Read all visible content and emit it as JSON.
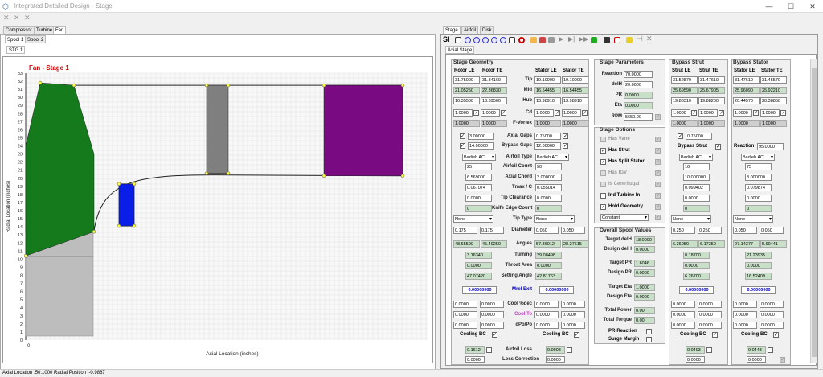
{
  "window": {
    "title": "Integrated Detailed Design - Stage",
    "minimize": "—",
    "maximize": "☐",
    "close": "✕"
  },
  "left": {
    "tabs": [
      "Compressor",
      "Turbine",
      "Fan"
    ],
    "spool_tabs": [
      "Spool 1",
      "Spool 2"
    ],
    "stage_tab": "STG 1",
    "plot": {
      "title": "Fan - Stage 1",
      "xlabel": "Axial Location (inches)",
      "ylabel": "Radial Location (inches)",
      "x_zero": "0",
      "yticks": [
        "0",
        "1",
        "2",
        "3",
        "4",
        "5",
        "6",
        "7",
        "8",
        "9",
        "10",
        "11",
        "12",
        "13",
        "14",
        "15",
        "16",
        "17",
        "18",
        "19",
        "20",
        "21",
        "22",
        "23",
        "24",
        "25",
        "26",
        "27",
        "28",
        "29",
        "30",
        "31",
        "32",
        "33"
      ],
      "colors": {
        "rotor": "#157a1c",
        "stator": "#7f7f7f",
        "bypass": "#7a0a82",
        "core": "#0a1ee8",
        "hub": "#bdbdbd"
      }
    }
  },
  "right": {
    "tabs": [
      "Stage",
      "Airfoil",
      "Disk"
    ],
    "subtab": "Axial Stage",
    "geometry": {
      "header": "Stage Geometry",
      "col_headers": [
        "Rotor LE",
        "Rotor TE",
        "Stator LE",
        "Stator TE"
      ],
      "rows": [
        {
          "label": "Tip",
          "rotor": [
            "31.75000",
            "31.34160"
          ],
          "stator": [
            "19.10000",
            "19.10000"
          ]
        },
        {
          "label": "Mid",
          "rotor": [
            "21.05250",
            "22.36830"
          ],
          "stator": [
            "16.54455",
            "16.54455"
          ]
        },
        {
          "label": "Hub",
          "rotor": [
            "10.35500",
            "13.39500"
          ],
          "stator": [
            "13.98910",
            "13.98910"
          ]
        },
        {
          "label": "Cd",
          "rotor": [
            "1.0000",
            "1.0000"
          ],
          "stator": [
            "1.0000",
            "1.0000"
          ]
        },
        {
          "label": "F-Vortex",
          "rotor": [
            "1.0000",
            "1.0000"
          ],
          "stator": [
            "1.0000",
            "1.0000"
          ]
        }
      ],
      "axial_gaps": {
        "label": "Axial Gaps",
        "rotor": "3.00000",
        "stator": "0.75000"
      },
      "bypass_gaps": {
        "label": "Bypass Gaps",
        "rotor": "14.00000",
        "stator": "12.00000"
      },
      "airfoil_type": {
        "label": "Airfoil Type",
        "rotor": "Badieh AC",
        "stator": "Badieh AC"
      },
      "airfoil_count": {
        "label": "Airfoil Count",
        "rotor": "25",
        "stator": "50"
      },
      "axial_chord": {
        "label": "Axial Chord",
        "rotor": "6.569000",
        "stator": "2.000000"
      },
      "tmax_c": {
        "label": "Tmax / C",
        "rotor": "0.067074",
        "stator": "0.055014"
      },
      "tip_clearance": {
        "label": "Tip Clearance",
        "rotor": "0.0000",
        "stator": "0.0000"
      },
      "knife_edge": {
        "label": "Knife Edge Count",
        "rotor": "0",
        "stator": "0"
      },
      "tip_type": {
        "label": "Tip Type",
        "rotor": "None",
        "stator": "None"
      },
      "diameter": {
        "label": "Diameter",
        "rotor": [
          "0.175",
          "0.175"
        ],
        "stator": [
          "0.050",
          "0.050"
        ]
      },
      "angles": {
        "label": "Angles",
        "rotor": [
          "48.65590",
          "45.49250"
        ],
        "stator": [
          "57.36012",
          "28.27515"
        ]
      },
      "turning": {
        "label": "Turning",
        "rotor": "3.16340",
        "stator": "29.08498"
      },
      "throat_area": {
        "label": "Throat Area",
        "rotor": "0.0000",
        "stator": "0.0000"
      },
      "setting_angle": {
        "label": "Setting Angle",
        "rotor": "47.07420",
        "stator": "42.81763"
      },
      "mrel_exit": {
        "label": "Mrel Exit",
        "rotor": "0.00000000",
        "stator": "0.00000000"
      },
      "cool_pct": {
        "label": "Cool %dec",
        "rotor": [
          "0.0000",
          "0.0000"
        ],
        "stator": [
          "0.0000",
          "0.0000"
        ]
      },
      "cool_to": {
        "label": "Cool To",
        "rotor": [
          "0.0000",
          "0.0000"
        ],
        "stator": [
          "0.0000",
          "0.0000"
        ]
      },
      "dpo_po": {
        "label": "dPo/Po",
        "rotor": [
          "0.0000",
          "0.0000"
        ],
        "stator": [
          "0.0000",
          "0.0000"
        ]
      },
      "cooling_bc": "Cooling BC",
      "airfoil_loss": {
        "label": "Airfoil Loss",
        "rotor": "0.1612",
        "stator": "0.0908"
      },
      "loss_correction": {
        "label": "Loss Correction",
        "rotor": "0.0000",
        "stator": "0.0000"
      }
    },
    "params": {
      "header": "Stage Parameters",
      "reaction": {
        "label": "Reaction",
        "value": "70.0000"
      },
      "delh": {
        "label": "delH",
        "value": "20.0000"
      },
      "pr": {
        "label": "PR",
        "value": "0.0000"
      },
      "eta": {
        "label": "Eta",
        "value": "0.0000"
      },
      "rpm": {
        "label": "RPM",
        "value": "5650.00"
      }
    },
    "options": {
      "header": "Stage Options",
      "items": [
        {
          "label": "Has Vane",
          "checked": false,
          "enabled": false
        },
        {
          "label": "Has Strut",
          "checked": true,
          "enabled": true
        },
        {
          "label": "Has Split Stator",
          "checked": true,
          "enabled": true
        },
        {
          "label": "Has IGV",
          "checked": false,
          "enabled": false
        },
        {
          "label": "is Centrifugal",
          "checked": false,
          "enabled": false
        },
        {
          "label": "Ind Turbine In",
          "checked": false,
          "enabled": true
        },
        {
          "label": "Hold Geometry",
          "checked": true,
          "enabled": true
        }
      ],
      "constant": "Constant"
    },
    "spool": {
      "header": "Overall Spool Values",
      "target_delh": {
        "label": "Target delH",
        "value": "18.0000"
      },
      "design_delh": {
        "label": "Design delH",
        "value": "0.0000"
      },
      "target_pr": {
        "label": "Target PR",
        "value": "1.6046"
      },
      "design_pr": {
        "label": "Design PR",
        "value": "0.0000"
      },
      "target_eta": {
        "label": "Target Eta",
        "value": "1.0000"
      },
      "design_eta": {
        "label": "Design Eta",
        "value": "0.0000"
      },
      "total_power": {
        "label": "Total Power",
        "value": "0.00"
      },
      "total_torque": {
        "label": "Total Torque",
        "value": "0.00"
      },
      "pr_reaction": "PR-Reaction",
      "surge_margin": "Surge Margin"
    },
    "bypass_strut": {
      "header": "Bypass Strut",
      "col_headers": [
        "Strut LE",
        "Strut TE"
      ],
      "tip": [
        "31.52870",
        "31.47610"
      ],
      "mid": [
        "25.69590",
        "25.67905"
      ],
      "hub": [
        "19.86310",
        "19.88200"
      ],
      "cd": [
        "1.0000",
        "1.0000"
      ],
      "fvortex": [
        "1.0000",
        "1.0000"
      ],
      "axial_gap": "0.75000",
      "sublabel": "Bypass Strut",
      "airfoil_type": "Badieh AC",
      "count": "16",
      "chord": "10.000000",
      "tmax": "0.099402",
      "clearance": "0.0000",
      "knife": "0",
      "tip_type": "None",
      "diameter": [
        "0.250",
        "0.250"
      ],
      "angles": [
        "6.36050",
        "6.17350"
      ],
      "turning": "0.18700",
      "throat": "0.0000",
      "setting": "6.26700",
      "mrel": "0.00000000",
      "cool_pct": [
        "0.0000",
        "0.0000"
      ],
      "cool_to": [
        "0.0000",
        "0.0000"
      ],
      "dpo": [
        "0.0000",
        "0.0000"
      ],
      "cooling_bc": "Cooling BC",
      "loss": "0.0493",
      "loss_corr": "0.0000"
    },
    "bypass_stator": {
      "header": "Bypass Stator",
      "col_headers": [
        "Stator LE",
        "Stator TE"
      ],
      "tip": [
        "31.47610",
        "31.45570"
      ],
      "mid": [
        "25.96090",
        "25.92210"
      ],
      "hub": [
        "20.44570",
        "20.38850"
      ],
      "cd": [
        "1.0000",
        "1.0000"
      ],
      "fvortex": [
        "1.0000",
        "1.0000"
      ],
      "reaction_label": "Reaction",
      "reaction": "95.0000",
      "airfoil_type": "Badieh AC",
      "count": "75",
      "chord": "3.000000",
      "tmax": "0.079874",
      "clearance": "0.0000",
      "knife": "0",
      "tip_type": "None",
      "diameter": [
        "0.050",
        "0.050"
      ],
      "angles": [
        "27.14377",
        "5.90441"
      ],
      "turning": "21.23935",
      "throat": "0.0000",
      "setting": "16.52409",
      "mrel": "0.00000000",
      "cool_pct": [
        "0.0000",
        "0.0000"
      ],
      "cool_to": [
        "0.0000",
        "0.0000"
      ],
      "dpo": [
        "0.0000",
        "0.0000"
      ],
      "cooling_bc": "Cooling BC",
      "loss": "0.0443",
      "loss_corr": "0.0000"
    }
  },
  "status": "Axial Location :50.1000  Radial Position :-0.9867"
}
